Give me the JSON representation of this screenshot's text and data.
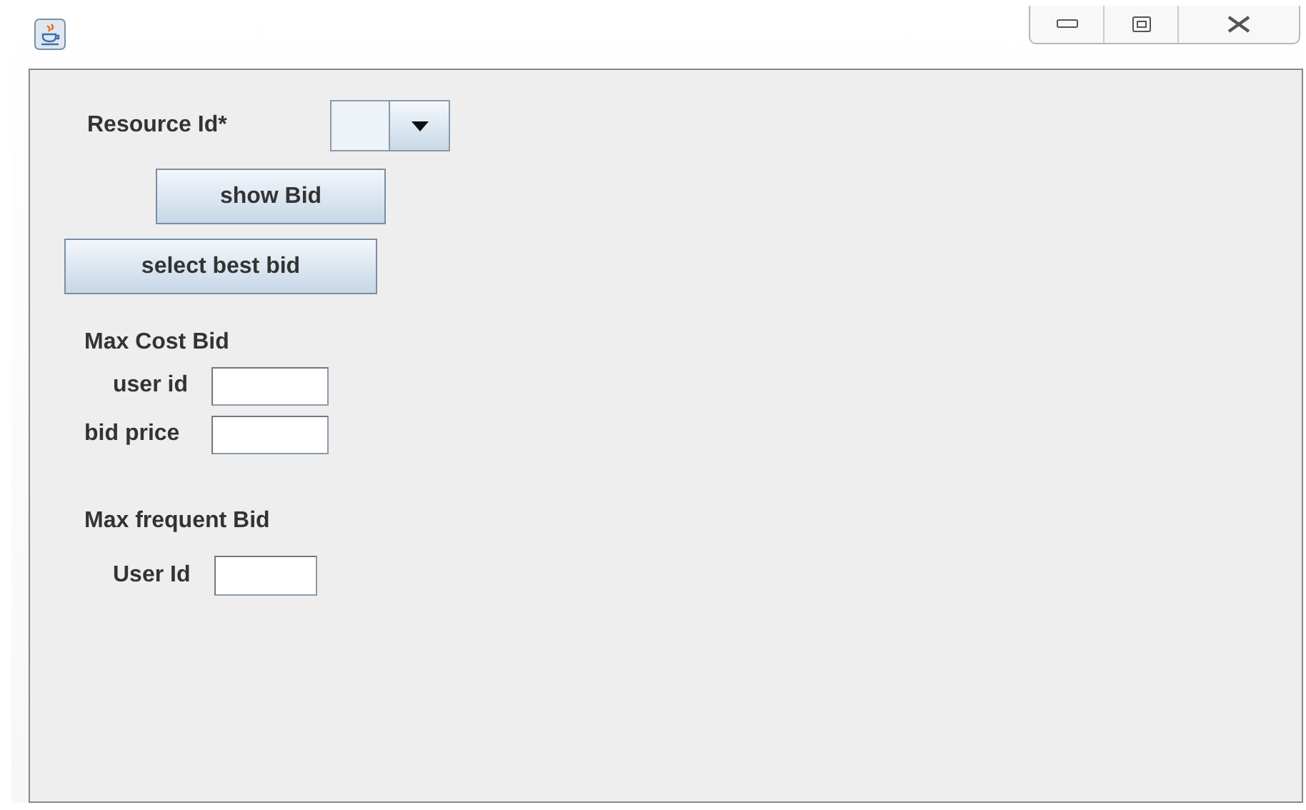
{
  "window": {
    "controls": [
      {
        "kind": "minimize"
      },
      {
        "kind": "maximize"
      },
      {
        "kind": "close"
      }
    ]
  },
  "resource": {
    "label": "Resource Id*"
  },
  "buttons": [
    "show Bid",
    "select best bid"
  ],
  "max_cost": {
    "heading": "Max Cost Bid",
    "fields": [
      {
        "label": "user id"
      },
      {
        "label": "bid price"
      }
    ]
  },
  "max_frequent": {
    "heading": "Max frequent Bid",
    "fields": [
      {
        "label": "User Id"
      }
    ]
  }
}
